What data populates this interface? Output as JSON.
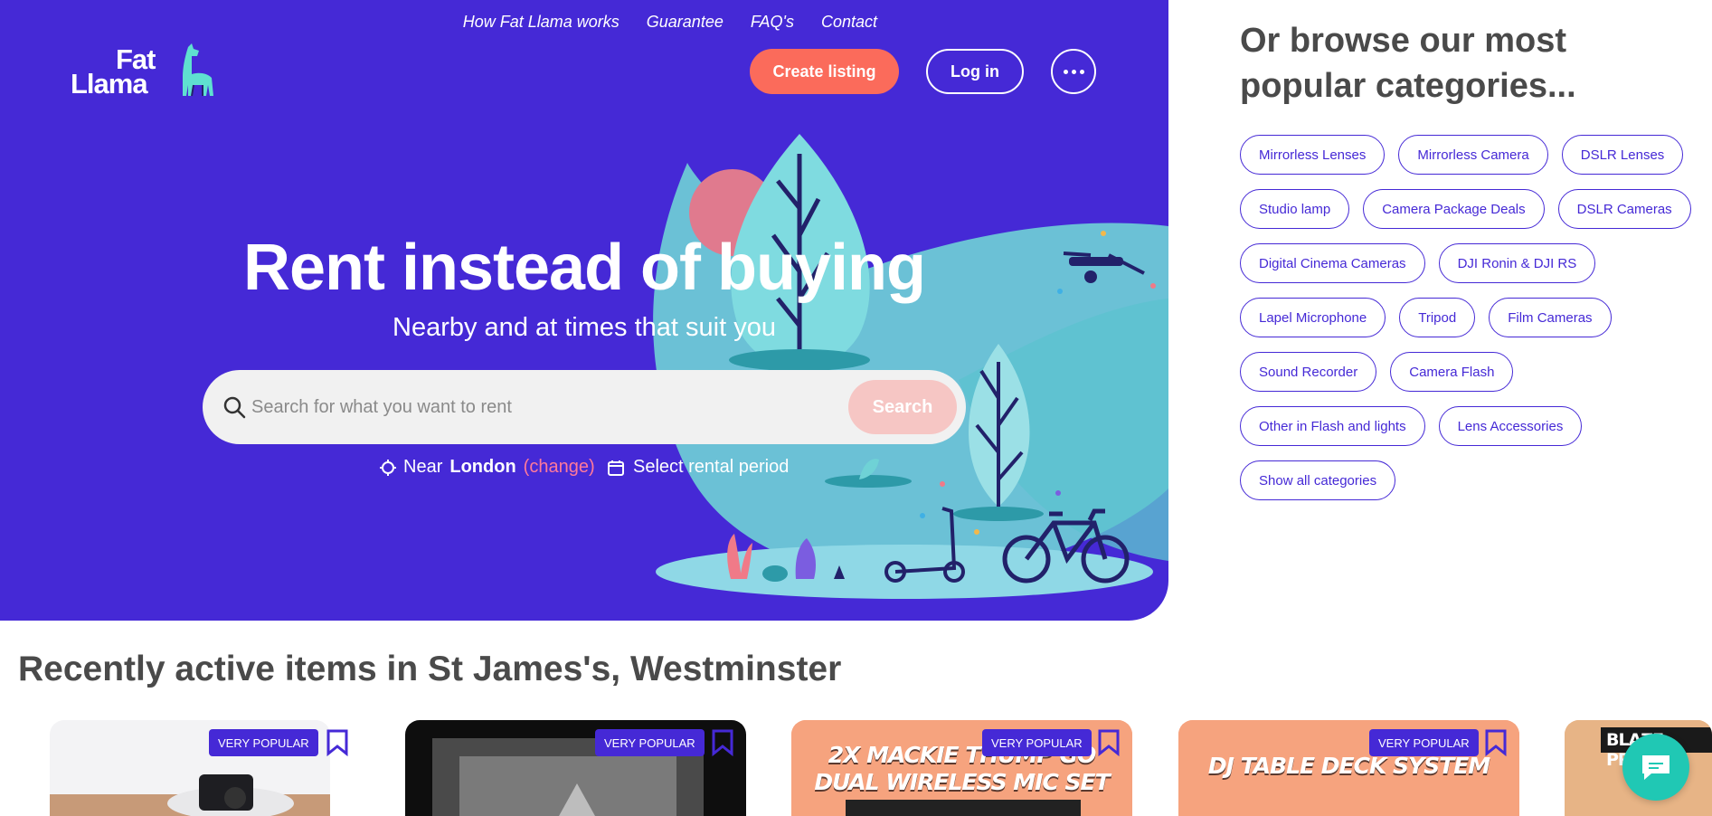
{
  "brand": {
    "logo_line1": "Fat",
    "logo_line2": "Llama"
  },
  "nav": {
    "links": [
      "How Fat Llama works",
      "Guarantee",
      "FAQ's",
      "Contact"
    ],
    "create_listing": "Create listing",
    "login": "Log in"
  },
  "hero": {
    "title": "Rent instead of buying",
    "subtitle": "Nearby and at times that suit you",
    "search_placeholder": "Search for what you want to rent",
    "search_button": "Search",
    "near_prefix": "Near",
    "near_location": "London",
    "near_change": "(change)",
    "rental_period": "Select rental period"
  },
  "categories": {
    "title": "Or browse our most popular categories...",
    "items": [
      "Mirrorless Lenses",
      "Mirrorless Camera",
      "DSLR Lenses",
      "Studio lamp",
      "Camera Package Deals",
      "DSLR Cameras",
      "Digital Cinema Cameras",
      "DJI Ronin & DJI RS",
      "Lapel Microphone",
      "Tripod",
      "Film Cameras",
      "Sound Recorder",
      "Camera Flash",
      "Other in Flash and lights",
      "Lens Accessories",
      "Show all categories"
    ]
  },
  "recent": {
    "title": "Recently active items in St James's, Westminster",
    "cards": [
      {
        "badge": "VERY POPULAR",
        "caption": ""
      },
      {
        "badge": "VERY POPULAR",
        "caption": ""
      },
      {
        "badge": "VERY POPULAR",
        "caption_line1": "2X MACKIE THUMP GO",
        "caption_line2": "DUAL WIRELESS MIC SET"
      },
      {
        "badge": "VERY POPULAR",
        "caption_line1": "DJ TABLE DECK SYSTEM"
      },
      {
        "caption_line1": "BLAZE PREMUS"
      }
    ]
  },
  "colors": {
    "brand_purple": "#4529d6",
    "coral": "#fb6b5b",
    "teal": "#20c8b4"
  }
}
